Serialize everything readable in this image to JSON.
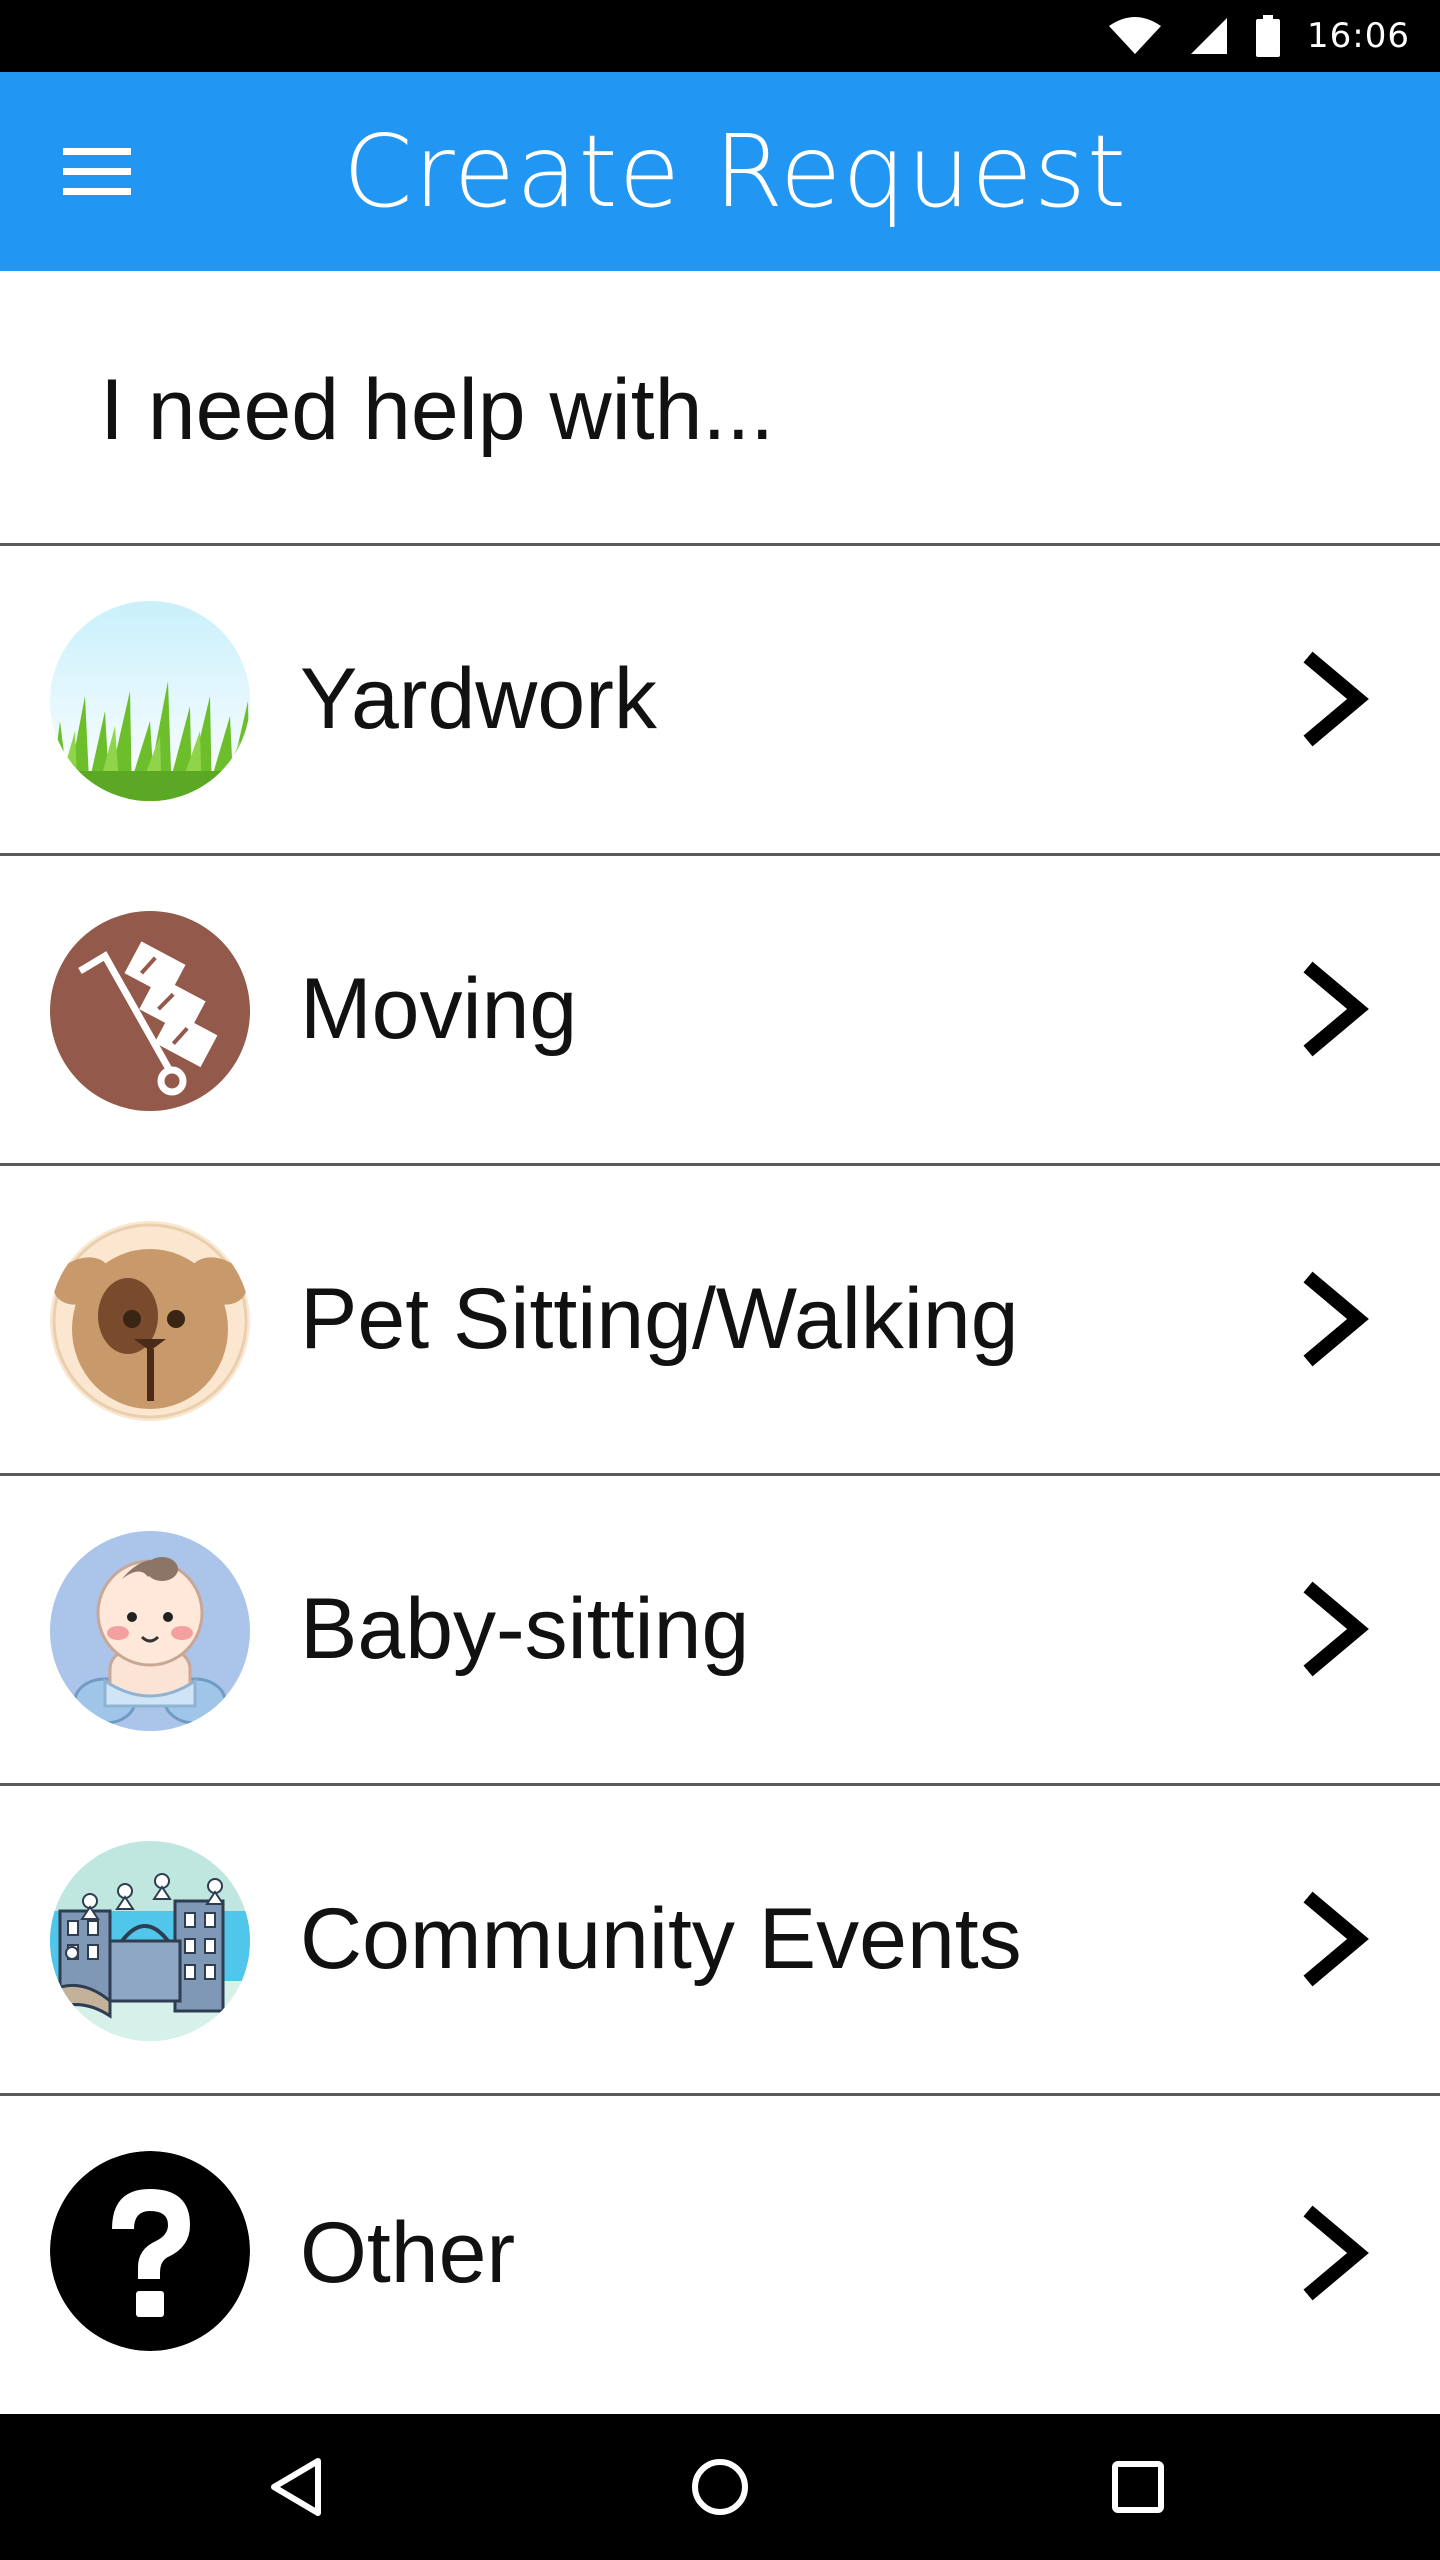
{
  "status_bar": {
    "time": "16:06",
    "icons": [
      "wifi-icon",
      "cell-signal-icon",
      "battery-icon"
    ]
  },
  "app_bar": {
    "title": "Create Request",
    "menu_icon": "hamburger-menu-icon",
    "background_color": "#2196f3"
  },
  "prompt": {
    "text": "I need help with..."
  },
  "categories": [
    {
      "label": "Yardwork",
      "icon": "grass-icon"
    },
    {
      "label": "Moving",
      "icon": "hand-truck-boxes-icon"
    },
    {
      "label": "Pet Sitting/Walking",
      "icon": "dog-face-icon"
    },
    {
      "label": "Baby-sitting",
      "icon": "baby-icon"
    },
    {
      "label": "Community Events",
      "icon": "city-community-icon"
    },
    {
      "label": "Other",
      "icon": "question-mark-icon"
    }
  ],
  "nav_bar": {
    "icons": [
      "back-icon",
      "home-icon",
      "recents-icon"
    ]
  }
}
